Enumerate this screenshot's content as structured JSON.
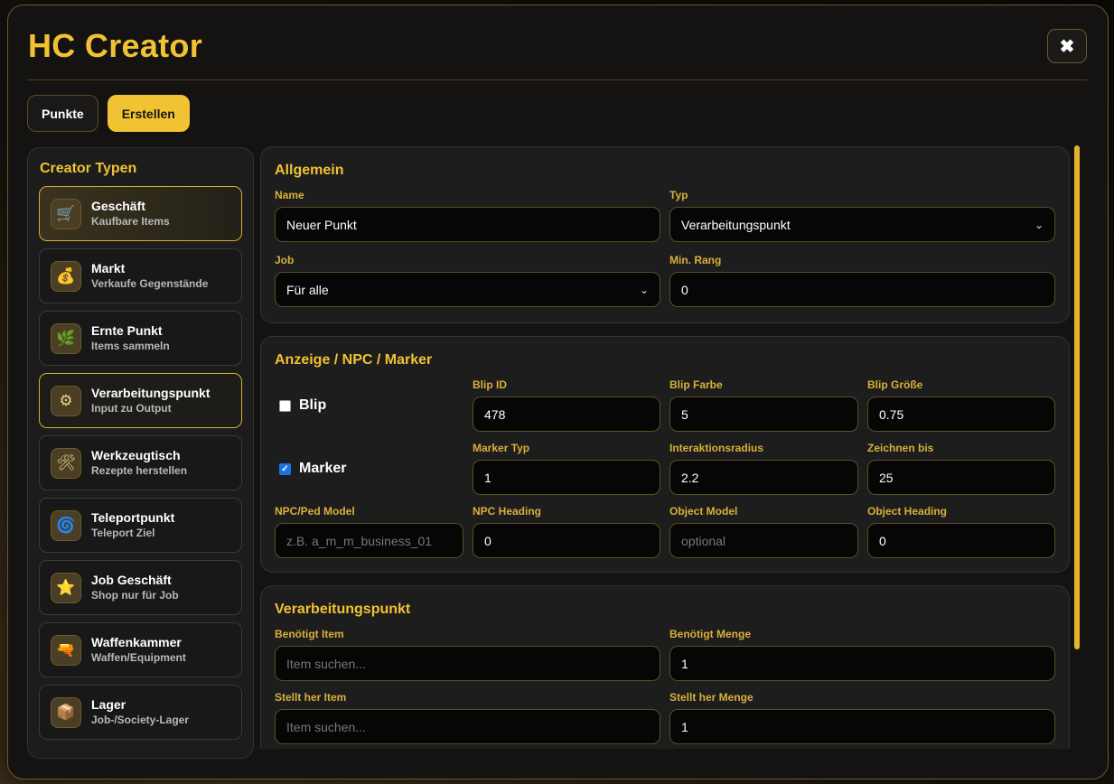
{
  "app": {
    "title": "HC Creator",
    "close_glyph": "✖"
  },
  "tabs": [
    {
      "label": "Punkte",
      "active": false
    },
    {
      "label": "Erstellen",
      "active": true
    }
  ],
  "sidebar": {
    "heading": "Creator Typen",
    "items": [
      {
        "title": "Geschäft",
        "subtitle": "Kaufbare Items",
        "icon": "cart-icon",
        "glyph": "🛒"
      },
      {
        "title": "Markt",
        "subtitle": "Verkaufe Gegenstände",
        "icon": "money-bag-icon",
        "glyph": "💰"
      },
      {
        "title": "Ernte Punkt",
        "subtitle": "Items sammeln",
        "icon": "herb-icon",
        "glyph": "🌿"
      },
      {
        "title": "Verarbeitungspunkt",
        "subtitle": "Input zu Output",
        "icon": "gear-icon",
        "glyph": "⚙"
      },
      {
        "title": "Werkzeugtisch",
        "subtitle": "Rezepte herstellen",
        "icon": "tools-icon",
        "glyph": "🛠"
      },
      {
        "title": "Teleportpunkt",
        "subtitle": "Teleport Ziel",
        "icon": "cyclone-icon",
        "glyph": "🌀"
      },
      {
        "title": "Job Geschäft",
        "subtitle": "Shop nur für Job",
        "icon": "star-icon",
        "glyph": "⭐"
      },
      {
        "title": "Waffenkammer",
        "subtitle": "Waffen/Equipment",
        "icon": "water-gun-icon",
        "glyph": "🔫"
      },
      {
        "title": "Lager",
        "subtitle": "Job-/Society-Lager",
        "icon": "package-icon",
        "glyph": "📦"
      }
    ]
  },
  "allgemein": {
    "heading": "Allgemein",
    "name_label": "Name",
    "name_value": "Neuer Punkt",
    "typ_label": "Typ",
    "typ_value": "Verarbeitungspunkt",
    "job_label": "Job",
    "job_value": "Für alle",
    "rang_label": "Min. Rang",
    "rang_value": "0"
  },
  "anzeige": {
    "heading": "Anzeige / NPC / Marker",
    "blip_label": "Blip",
    "blip_checked": false,
    "marker_label": "Marker",
    "marker_checked": true,
    "blip_id_label": "Blip ID",
    "blip_id_value": "478",
    "blip_farbe_label": "Blip Farbe",
    "blip_farbe_value": "5",
    "blip_groesse_label": "Blip Größe",
    "blip_groesse_value": "0.75",
    "marker_typ_label": "Marker Typ",
    "marker_typ_value": "1",
    "radius_label": "Interaktionsradius",
    "radius_value": "2.2",
    "zeichnen_label": "Zeichnen bis",
    "zeichnen_value": "25",
    "npc_model_label": "NPC/Ped Model",
    "npc_model_placeholder": "z.B. a_m_m_business_01",
    "npc_heading_label": "NPC Heading",
    "npc_heading_value": "0",
    "object_model_label": "Object Model",
    "object_model_placeholder": "optional",
    "object_heading_label": "Object Heading",
    "object_heading_value": "0"
  },
  "verarbeitung": {
    "heading": "Verarbeitungspunkt",
    "need_item_label": "Benötigt Item",
    "need_item_placeholder": "Item suchen...",
    "need_qty_label": "Benötigt Menge",
    "need_qty_value": "1",
    "make_item_label": "Stellt her Item",
    "make_item_placeholder": "Item suchen...",
    "make_qty_label": "Stellt her Menge",
    "make_qty_value": "1"
  }
}
